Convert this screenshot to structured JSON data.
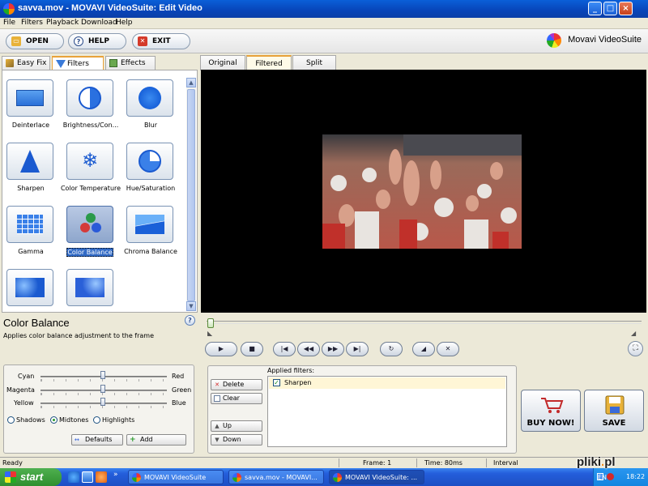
{
  "window": {
    "title": "savva.mov - MOVAVI VideoSuite: Edit Video",
    "controls": [
      "_",
      "□",
      "×"
    ]
  },
  "menu": [
    "File",
    "Filters",
    "Playback",
    "Download",
    "Help"
  ],
  "toolbar": {
    "open_label": "OPEN",
    "help_label": "HELP",
    "exit_label": "EXIT",
    "brand": "Movavi VideoSuite"
  },
  "left_tabs": [
    {
      "label": "Easy Fix",
      "icon": "wand-icon"
    },
    {
      "label": "Filters",
      "icon": "funnel-icon",
      "active": true
    },
    {
      "label": "Effects",
      "icon": "picture-icon"
    }
  ],
  "filters": [
    {
      "label": "Deinterlace",
      "icon": "deinterlace-icon"
    },
    {
      "label": "Brightness/Con...",
      "icon": "brightness-icon"
    },
    {
      "label": "Blur",
      "icon": "blur-icon"
    },
    {
      "label": "Sharpen",
      "icon": "sharpen-icon"
    },
    {
      "label": "Color Temperature",
      "icon": "snowflake-icon"
    },
    {
      "label": "Hue/Saturation",
      "icon": "hue-icon"
    },
    {
      "label": "Gamma",
      "icon": "gamma-icon"
    },
    {
      "label": "Color Balance",
      "icon": "color-balance-icon",
      "selected": true
    },
    {
      "label": "Chroma Balance",
      "icon": "chroma-icon"
    },
    {
      "label": "",
      "icon": "texture-icon"
    },
    {
      "label": "",
      "icon": "noise-icon"
    }
  ],
  "selected_filter": {
    "name": "Color Balance",
    "description": "Applies color balance adjustment to the frame",
    "help": "?"
  },
  "color_balance": {
    "sliders": [
      {
        "left": "Cyan",
        "right": "Red",
        "value": 0
      },
      {
        "left": "Magenta",
        "right": "Green",
        "value": 0
      },
      {
        "left": "Yellow",
        "right": "Blue",
        "value": 0
      }
    ],
    "ranges": [
      {
        "label": "Shadows",
        "checked": false
      },
      {
        "label": "Midtones",
        "checked": true
      },
      {
        "label": "Highlights",
        "checked": false
      }
    ],
    "defaults_label": "Defaults",
    "add_label": "Add"
  },
  "view_tabs": [
    {
      "label": "Original"
    },
    {
      "label": "Filtered",
      "active": true
    },
    {
      "label": "Split"
    }
  ],
  "playback": {
    "position": 0.0,
    "buttons": [
      "▶",
      "■",
      "|◀",
      "◀◀",
      "▶▶",
      "▶|",
      "↻",
      "◢",
      "✕"
    ],
    "fullscreen": "⛶"
  },
  "applied": {
    "delete_label": "Delete",
    "clear_label": "Clear",
    "up_label": "Up",
    "down_label": "Down",
    "title": "Applied filters:",
    "items": [
      {
        "label": "Sharpen",
        "checked": true
      }
    ]
  },
  "actions": {
    "buy_label": "BUY NOW!",
    "save_label": "SAVE"
  },
  "status": {
    "state": "Ready",
    "frame": "Frame: 1",
    "time": "Time: 80ms",
    "interval": "Interval"
  },
  "taskbar": {
    "start": "start",
    "tasks": [
      {
        "label": "MOVAVI VideoSuite"
      },
      {
        "label": "savva.mov - MOVAVI..."
      },
      {
        "label": "MOVAVI VideoSuite: ...",
        "active": true
      }
    ],
    "clock": "18:22",
    "lang": "EN"
  },
  "watermark": {
    "brand": "pliki",
    "dot": ".",
    "tld": "pl"
  },
  "colors": {
    "title_bar": "#0845b8",
    "selection": "#316ac5",
    "tab_accent": "#e8a23a",
    "taskbar": "#245edb",
    "start": "#2f8f2f"
  }
}
